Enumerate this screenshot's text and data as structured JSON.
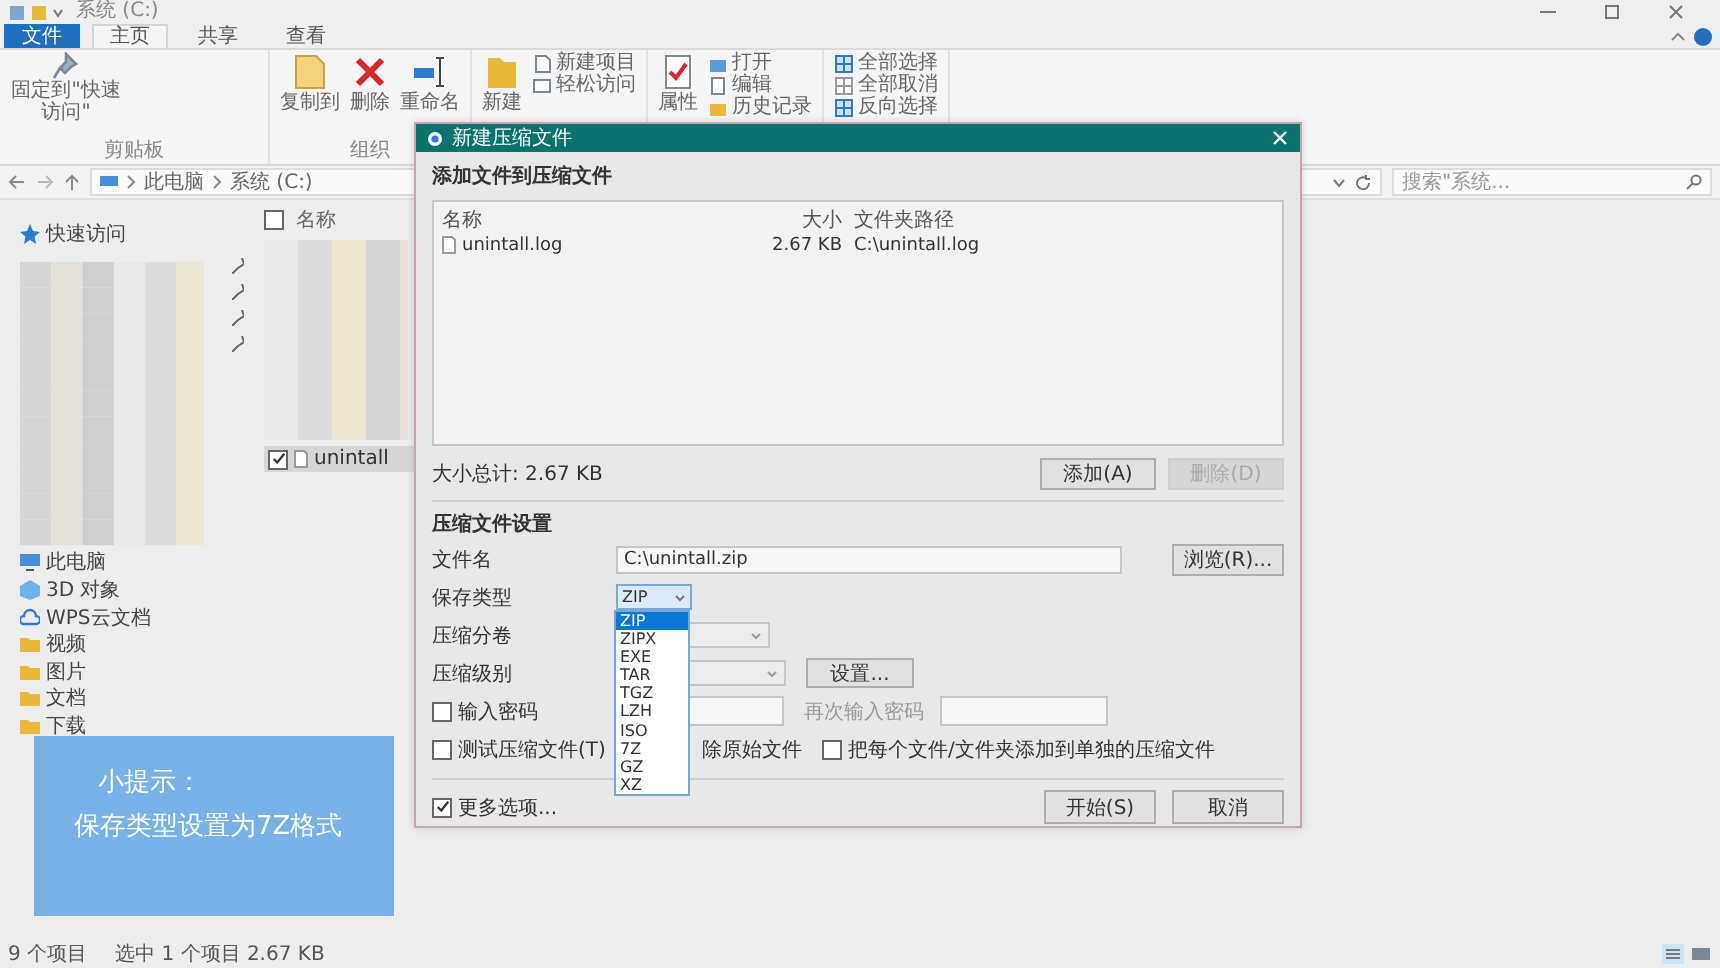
{
  "window": {
    "title": "系统 (C:)"
  },
  "ribbon_tabs": [
    {
      "label": "文件",
      "kind": "file",
      "selected": false
    },
    {
      "label": "主页",
      "kind": "tab",
      "selected": true
    },
    {
      "label": "共享",
      "kind": "tab",
      "selected": false
    },
    {
      "label": "查看",
      "kind": "tab",
      "selected": false
    }
  ],
  "ribbon_groups": [
    {
      "label": "剪贴板",
      "items": [
        {
          "label": "固定到\"快速访问\"",
          "kind": "big"
        }
      ]
    },
    {
      "label": "组织",
      "items": [
        {
          "label": "复制到",
          "kind": "big"
        },
        {
          "label": "删除",
          "kind": "big"
        },
        {
          "label": "重命名",
          "kind": "big"
        }
      ]
    },
    {
      "items": [
        {
          "label": "新建",
          "kind": "big"
        },
        {
          "label": "新建项目",
          "kind": "small"
        },
        {
          "label": "轻松访问",
          "kind": "small"
        }
      ]
    },
    {
      "items": [
        {
          "label": "属性",
          "kind": "big"
        },
        {
          "label": "打开",
          "kind": "small"
        },
        {
          "label": "编辑",
          "kind": "small"
        },
        {
          "label": "历史记录",
          "kind": "small"
        }
      ]
    },
    {
      "items": [
        {
          "label": "全部选择",
          "kind": "small"
        },
        {
          "label": "全部取消",
          "kind": "small"
        },
        {
          "label": "反向选择",
          "kind": "small"
        }
      ]
    }
  ],
  "address": {
    "path": [
      "此电脑",
      "系统 (C:)"
    ],
    "search_placeholder": "搜索\"系统..."
  },
  "nav": {
    "items": [
      {
        "label": "快速访问",
        "kind": "quick"
      },
      {
        "kind": "blurred"
      },
      {
        "label": "此电脑",
        "kind": "pc"
      },
      {
        "label": "3D 对象",
        "kind": "objects3d"
      },
      {
        "label": "WPS云文档",
        "kind": "cloud"
      },
      {
        "label": "视频",
        "kind": "video"
      },
      {
        "label": "图片",
        "kind": "pictures"
      },
      {
        "label": "文档",
        "kind": "docs"
      },
      {
        "label": "下载",
        "kind": "downloads"
      }
    ]
  },
  "files": {
    "column": "名称",
    "header_checked": false,
    "rows": [
      {
        "kind": "blurred"
      },
      {
        "kind": "file",
        "name": "unintall",
        "selected": true,
        "checked": true
      }
    ]
  },
  "status": {
    "count": "9 个项目",
    "selection": "选中 1 个项目 2.67 KB"
  },
  "dialog": {
    "title": "新建压缩文件",
    "files_section": "添加文件到压缩文件",
    "columns": [
      "名称",
      "大小",
      "文件夹路径"
    ],
    "rows": [
      {
        "name": "unintall.log",
        "size": "2.67 KB",
        "path": "C:\\unintall.log"
      }
    ],
    "total": "大小总计: 2.67 KB",
    "buttons": [
      {
        "label": "添加(A)",
        "disabled": false
      },
      {
        "label": "删除(D)",
        "disabled": true
      }
    ],
    "settings_section": "压缩文件设置",
    "filename": {
      "label": "文件名",
      "value": "C:\\unintall.zip",
      "button": "浏览(R)..."
    },
    "save_type": {
      "label": "保存类型",
      "value": "ZIP",
      "expanded": true,
      "options": [
        {
          "label": "ZIP",
          "selected": true
        },
        {
          "label": "ZIPX",
          "selected": false
        },
        {
          "label": "EXE",
          "selected": false
        },
        {
          "label": "TAR",
          "selected": false
        },
        {
          "label": "TGZ",
          "selected": false
        },
        {
          "label": "LZH",
          "selected": false
        },
        {
          "label": "ISO",
          "selected": false
        },
        {
          "label": "7Z",
          "selected": false
        },
        {
          "label": "GZ",
          "selected": false
        },
        {
          "label": "XZ",
          "selected": false
        }
      ]
    },
    "split": {
      "label": "压缩分卷"
    },
    "level": {
      "label": "压缩级别",
      "button": "设置..."
    },
    "password": {
      "label": "输入密码",
      "checked": false,
      "confirm_label": "再次输入密码"
    },
    "options": [
      {
        "label": "测试压缩文件(T)",
        "checked": false
      },
      {
        "label": "除原始文件"
      },
      {
        "label": "把每个文件/文件夹添加到单独的压缩文件",
        "checked": false
      }
    ],
    "more": {
      "label": "更多选项...",
      "checked": true
    },
    "footer_buttons": [
      "开始(S)",
      "取消"
    ]
  },
  "tip": {
    "title": "小提示：",
    "text": "保存类型设置为7Z格式"
  }
}
